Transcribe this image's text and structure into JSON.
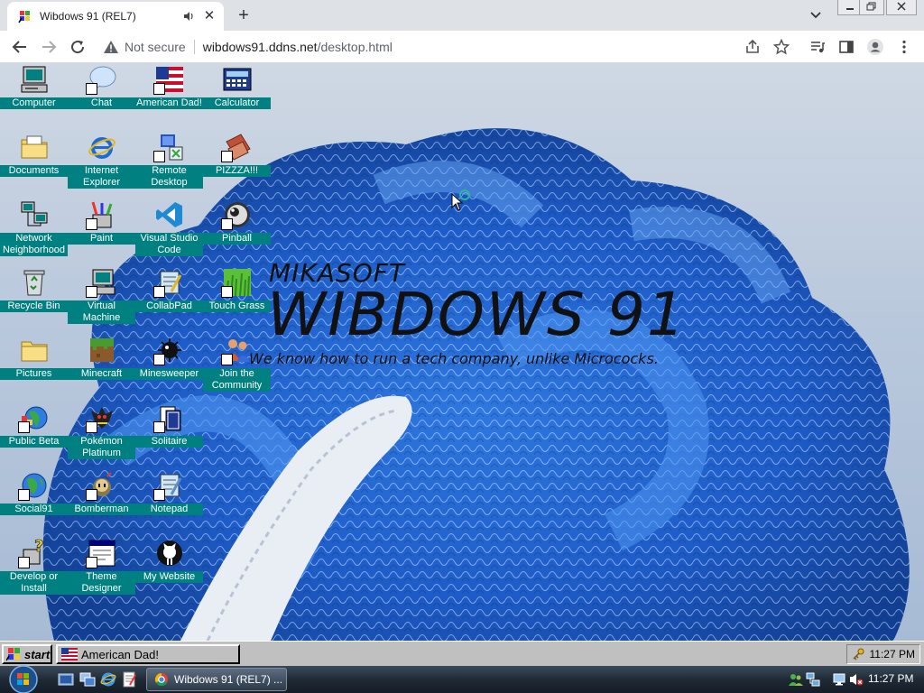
{
  "browser": {
    "tab_title": "Wibdows 91 (REL7)",
    "new_tab": "+",
    "security": "Not secure",
    "url_host": "wibdows91.ddns.net",
    "url_path": "/desktop.html"
  },
  "brand": {
    "top": "MIKASOFT",
    "main": "WIBDOWS 91",
    "tagline": "We know how to run a tech company, unlike Micrococks."
  },
  "icons": [
    {
      "label": "Computer"
    },
    {
      "label": "Chat"
    },
    {
      "label": "American Dad!"
    },
    {
      "label": "Calculator"
    },
    {
      "label": "Documents"
    },
    {
      "label": "Internet Explorer"
    },
    {
      "label": "Remote Desktop"
    },
    {
      "label": "PIZZZA!!!"
    },
    {
      "label": "Network Neighborhood"
    },
    {
      "label": "Paint"
    },
    {
      "label": "Visual Studio Code"
    },
    {
      "label": "Pinball"
    },
    {
      "label": "Recycle Bin"
    },
    {
      "label": "Virtual Machine"
    },
    {
      "label": "CollabPad"
    },
    {
      "label": "Touch Grass"
    },
    {
      "label": "Pictures"
    },
    {
      "label": "Minecraft"
    },
    {
      "label": "Minesweeper"
    },
    {
      "label": "Join the Community"
    },
    {
      "label": "Public Beta"
    },
    {
      "label": "Pokémon Platinum"
    },
    {
      "label": "Solitaire"
    },
    {
      "label": "Social91"
    },
    {
      "label": "Bomberman"
    },
    {
      "label": "Notepad"
    },
    {
      "label": "Develop or Install"
    },
    {
      "label": "Theme Designer"
    },
    {
      "label": "My Website"
    }
  ],
  "taskbar95": {
    "start": "start",
    "task": "American Dad!",
    "clock": "11:27 PM"
  },
  "taskbar7": {
    "task": "Wibdows 91 (REL7) ...",
    "clock": "11:27 PM"
  },
  "colors": {
    "icon_label_bg": "#008080",
    "win95_gray": "#c0c0c0"
  }
}
